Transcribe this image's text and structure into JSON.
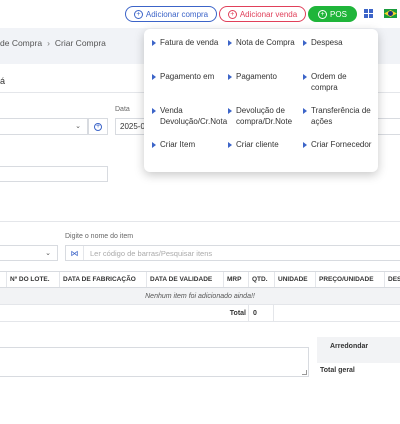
{
  "topbar": {
    "add_purchase": "Adicionar compra",
    "add_sale": "Adicionar venda",
    "pos": "POS"
  },
  "breadcrumb": [
    "de Compra",
    "Criar Compra"
  ],
  "page": {
    "title": "á",
    "date_label": "Data",
    "date_value": "2025-0",
    "item_label": "Digite o nome do item",
    "barcode_placeholder": "Ler código de barras/Pesquisar itens"
  },
  "table": {
    "columns": [
      "",
      "Nº DO LOTE.",
      "DATA DE FABRICAÇÃO",
      "DATA DE VALIDADE",
      "MRP",
      "QTD.",
      "UNIDADE",
      "PREÇO/UNIDADE",
      "DES"
    ],
    "empty_message": "Nenhum item foi adicionado ainda!!",
    "total_label": "Total",
    "total_value": "0"
  },
  "summary": {
    "round_label": "Arredondar",
    "grand_total_label": "Total geral"
  },
  "dropdown": {
    "items": [
      "Fatura de venda",
      "Nota de Compra",
      "Despesa",
      "Pagamento em",
      "Pagamento",
      "Ordem de compra",
      "Venda Devolução/Cr.Nota",
      "Devolução de compra/Dr.Note",
      "Transferência de ações",
      "Criar Item",
      "Criar cliente",
      "Criar Fornecedor"
    ]
  },
  "colors": {
    "accent": "#3c64c8",
    "danger": "#e0405a",
    "success": "#1fb53a"
  }
}
